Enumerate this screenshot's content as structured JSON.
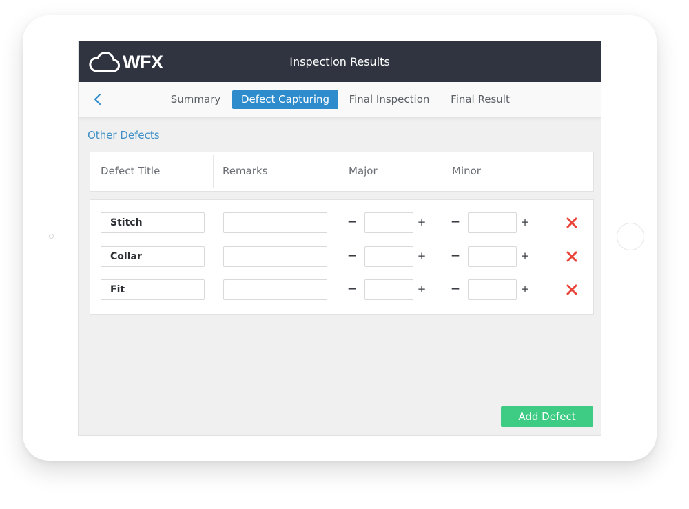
{
  "header": {
    "logo_text": "WFX",
    "title": "Inspection Results"
  },
  "tabs": [
    {
      "label": "Summary",
      "active": false
    },
    {
      "label": "Defect Capturing",
      "active": true
    },
    {
      "label": "Final Inspection",
      "active": false
    },
    {
      "label": "Final Result",
      "active": false
    }
  ],
  "section": {
    "title": "Other Defects"
  },
  "table": {
    "columns": [
      "Defect Title",
      "Remarks",
      "Major",
      "Minor"
    ],
    "rows": [
      {
        "title": "Stitch",
        "remarks": "",
        "major": "",
        "minor": ""
      },
      {
        "title": "Collar",
        "remarks": "",
        "major": "",
        "minor": ""
      },
      {
        "title": "Fit",
        "remarks": "",
        "major": "",
        "minor": ""
      }
    ],
    "minus_label": "−",
    "plus_label": "+"
  },
  "actions": {
    "add_defect_label": "Add Defect"
  },
  "colors": {
    "header_bg": "#2f3440",
    "accent": "#2e8ccc",
    "add_button": "#3ecb83",
    "delete": "#e8443a"
  }
}
